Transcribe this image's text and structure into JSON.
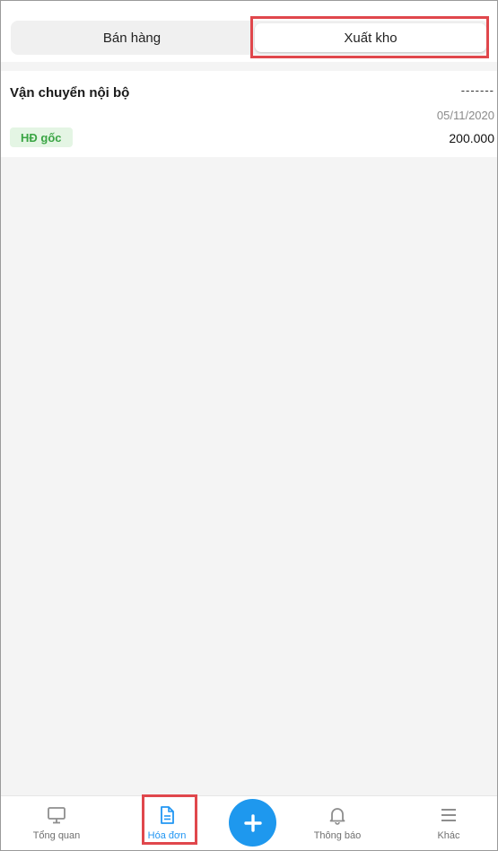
{
  "tabs": {
    "sales_label": "Bán hàng",
    "export_label": "Xuất kho"
  },
  "invoice": {
    "title": "Vận chuyển nội bộ",
    "code": "-------",
    "date": "05/11/2020",
    "badge": "HĐ gốc",
    "amount": "200.000"
  },
  "nav": {
    "overview": "Tổng quan",
    "invoice": "Hóa đơn",
    "notifications": "Thông báo",
    "more": "Khác",
    "icons": [
      "monitor-icon",
      "document-icon",
      "plus-icon",
      "bell-icon",
      "menu-icon"
    ]
  },
  "colors": {
    "accent": "#2196f3",
    "fab": "#1e98ee",
    "badge_text": "#3aa544",
    "badge_bg": "#e4f5e4",
    "highlight": "#e0474c"
  }
}
